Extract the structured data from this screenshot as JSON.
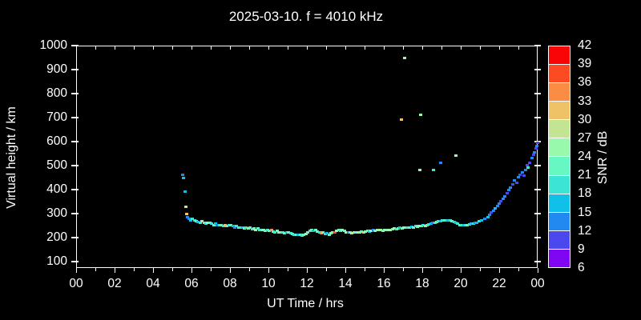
{
  "title": "2025-03-10. f = 4010 kHz",
  "axes": {
    "x": {
      "label": "UT Time / hrs",
      "range": [
        0,
        24
      ],
      "major_tick_hours": [
        0,
        2,
        4,
        6,
        8,
        10,
        12,
        14,
        16,
        18,
        20,
        22,
        24
      ],
      "tick_labels": [
        "00",
        "02",
        "04",
        "06",
        "08",
        "10",
        "12",
        "14",
        "16",
        "18",
        "20",
        "22",
        "00"
      ],
      "minor_tick_hours": [
        1,
        3,
        5,
        7,
        9,
        11,
        13,
        15,
        17,
        19,
        21,
        23
      ]
    },
    "y": {
      "label": "Virtual height / km",
      "range": [
        73,
        1000
      ],
      "tick_values": [
        100,
        200,
        300,
        400,
        500,
        600,
        700,
        800,
        900,
        1000
      ]
    }
  },
  "colorbar": {
    "label": "SNR / dB",
    "tick_values": [
      6,
      9,
      12,
      15,
      18,
      21,
      24,
      27,
      30,
      33,
      36,
      39,
      42
    ],
    "segment_colors_bottom_to_top": [
      "#7F05F3",
      "#4B48EE",
      "#2289F0",
      "#10C0E8",
      "#3BE4D4",
      "#66F7C2",
      "#98F8AB",
      "#C3E593",
      "#EFC268",
      "#FB8C44",
      "#FC4A22",
      "#FA0505"
    ],
    "background": "#000000",
    "foreground": "#ffffff"
  },
  "chart_data": {
    "type": "scatter",
    "title": "2025-03-10. f = 4010 kHz",
    "xlabel": "UT Time / hrs",
    "ylabel": "Virtual height / km",
    "zlabel": "SNR / dB",
    "xlim": [
      0,
      24
    ],
    "ylim": [
      73,
      1000
    ],
    "zlim": [
      6,
      42
    ],
    "grid": false,
    "point_format": "[time_hours, virtual_height_km, snr_db]",
    "points": [
      [
        5.55,
        460,
        13
      ],
      [
        5.6,
        447,
        16
      ],
      [
        5.67,
        390,
        16
      ],
      [
        5.72,
        327,
        28
      ],
      [
        5.76,
        298,
        31
      ],
      [
        5.8,
        285,
        13
      ],
      [
        5.87,
        278,
        13
      ],
      [
        5.95,
        270,
        16
      ],
      [
        6.05,
        277,
        19
      ],
      [
        6.15,
        272,
        19
      ],
      [
        6.25,
        268,
        22
      ],
      [
        6.35,
        265,
        16
      ],
      [
        6.45,
        263,
        19
      ],
      [
        6.55,
        268,
        28
      ],
      [
        6.65,
        262,
        22
      ],
      [
        6.75,
        258,
        19
      ],
      [
        6.85,
        262,
        25
      ],
      [
        6.95,
        260,
        22
      ],
      [
        7.05,
        257,
        19
      ],
      [
        7.15,
        253,
        22
      ],
      [
        7.25,
        257,
        16
      ],
      [
        7.35,
        252,
        13
      ],
      [
        7.45,
        250,
        19
      ],
      [
        7.55,
        253,
        22
      ],
      [
        7.65,
        248,
        19
      ],
      [
        7.75,
        250,
        31
      ],
      [
        7.85,
        247,
        22
      ],
      [
        7.95,
        253,
        19
      ],
      [
        8.05,
        250,
        22
      ],
      [
        8.15,
        247,
        16
      ],
      [
        8.25,
        243,
        13
      ],
      [
        8.35,
        247,
        19
      ],
      [
        8.45,
        243,
        22
      ],
      [
        8.55,
        240,
        19
      ],
      [
        8.65,
        243,
        16
      ],
      [
        8.75,
        238,
        22
      ],
      [
        8.85,
        240,
        19
      ],
      [
        8.95,
        237,
        25
      ],
      [
        9.05,
        240,
        22
      ],
      [
        9.15,
        235,
        19
      ],
      [
        9.25,
        237,
        22
      ],
      [
        9.35,
        233,
        28
      ],
      [
        9.45,
        237,
        22
      ],
      [
        9.55,
        233,
        19
      ],
      [
        9.65,
        230,
        22
      ],
      [
        9.75,
        233,
        25
      ],
      [
        9.85,
        228,
        22
      ],
      [
        9.95,
        230,
        19
      ],
      [
        10.05,
        227,
        22
      ],
      [
        10.15,
        230,
        34
      ],
      [
        10.25,
        225,
        22
      ],
      [
        10.35,
        223,
        19
      ],
      [
        10.45,
        227,
        22
      ],
      [
        10.55,
        223,
        25
      ],
      [
        10.65,
        220,
        22
      ],
      [
        10.75,
        223,
        19
      ],
      [
        10.85,
        218,
        22
      ],
      [
        10.95,
        220,
        16
      ],
      [
        11.05,
        223,
        22
      ],
      [
        11.15,
        218,
        19
      ],
      [
        11.25,
        215,
        22
      ],
      [
        11.35,
        212,
        19
      ],
      [
        11.45,
        210,
        22
      ],
      [
        11.55,
        213,
        16
      ],
      [
        11.65,
        210,
        22
      ],
      [
        11.75,
        208,
        19
      ],
      [
        11.85,
        212,
        22
      ],
      [
        11.95,
        215,
        25
      ],
      [
        12.05,
        220,
        22
      ],
      [
        12.15,
        228,
        19
      ],
      [
        12.25,
        230,
        22
      ],
      [
        12.35,
        228,
        16
      ],
      [
        12.45,
        230,
        22
      ],
      [
        12.55,
        225,
        22
      ],
      [
        12.65,
        222,
        19
      ],
      [
        12.75,
        218,
        34
      ],
      [
        12.85,
        220,
        22
      ],
      [
        12.95,
        215,
        19
      ],
      [
        13.05,
        217,
        16
      ],
      [
        13.15,
        213,
        22
      ],
      [
        13.25,
        217,
        25
      ],
      [
        13.35,
        220,
        22
      ],
      [
        13.45,
        223,
        37
      ],
      [
        13.55,
        228,
        25
      ],
      [
        13.65,
        230,
        22
      ],
      [
        13.75,
        228,
        19
      ],
      [
        13.85,
        230,
        25
      ],
      [
        13.95,
        227,
        22
      ],
      [
        14.05,
        223,
        25
      ],
      [
        14.15,
        220,
        13
      ],
      [
        14.25,
        222,
        22
      ],
      [
        14.35,
        218,
        28
      ],
      [
        14.45,
        220,
        25
      ],
      [
        14.55,
        223,
        22
      ],
      [
        14.65,
        220,
        28
      ],
      [
        14.75,
        222,
        25
      ],
      [
        14.85,
        225,
        22
      ],
      [
        14.95,
        222,
        31
      ],
      [
        15.05,
        225,
        25
      ],
      [
        15.15,
        228,
        22
      ],
      [
        15.25,
        225,
        16
      ],
      [
        15.35,
        228,
        25
      ],
      [
        15.45,
        230,
        13
      ],
      [
        15.55,
        228,
        22
      ],
      [
        15.65,
        230,
        25
      ],
      [
        15.75,
        233,
        28
      ],
      [
        15.85,
        230,
        25
      ],
      [
        15.95,
        228,
        22
      ],
      [
        16.05,
        230,
        25
      ],
      [
        16.15,
        233,
        22
      ],
      [
        16.25,
        230,
        28
      ],
      [
        16.35,
        233,
        25
      ],
      [
        16.45,
        235,
        22
      ],
      [
        16.55,
        238,
        25
      ],
      [
        16.65,
        235,
        19
      ],
      [
        16.75,
        238,
        22
      ],
      [
        16.85,
        240,
        16
      ],
      [
        16.95,
        238,
        22
      ],
      [
        17.05,
        240,
        25
      ],
      [
        17.15,
        243,
        22
      ],
      [
        17.25,
        240,
        19
      ],
      [
        17.35,
        243,
        22
      ],
      [
        17.45,
        245,
        16
      ],
      [
        17.55,
        243,
        22
      ],
      [
        17.65,
        247,
        19
      ],
      [
        17.75,
        245,
        22
      ],
      [
        17.85,
        248,
        25
      ],
      [
        17.95,
        247,
        22
      ],
      [
        18.05,
        250,
        19
      ],
      [
        18.15,
        248,
        28
      ],
      [
        18.25,
        252,
        22
      ],
      [
        18.35,
        255,
        19
      ],
      [
        18.45,
        258,
        16
      ],
      [
        18.55,
        260,
        13
      ],
      [
        18.65,
        262,
        19
      ],
      [
        18.75,
        265,
        22
      ],
      [
        18.85,
        267,
        19
      ],
      [
        18.95,
        268,
        16
      ],
      [
        19.05,
        270,
        19
      ],
      [
        19.15,
        272,
        22
      ],
      [
        19.25,
        273,
        19
      ],
      [
        19.35,
        272,
        16
      ],
      [
        19.45,
        270,
        19
      ],
      [
        19.55,
        268,
        22
      ],
      [
        19.65,
        265,
        19
      ],
      [
        19.75,
        260,
        16
      ],
      [
        19.85,
        257,
        19
      ],
      [
        19.95,
        253,
        22
      ],
      [
        20.05,
        252,
        19
      ],
      [
        20.15,
        250,
        16
      ],
      [
        20.25,
        252,
        19
      ],
      [
        20.35,
        253,
        22
      ],
      [
        20.45,
        255,
        19
      ],
      [
        20.55,
        257,
        16
      ],
      [
        20.65,
        258,
        19
      ],
      [
        20.75,
        260,
        13
      ],
      [
        20.85,
        263,
        16
      ],
      [
        20.95,
        267,
        19
      ],
      [
        21.1,
        272,
        16
      ],
      [
        21.25,
        278,
        13
      ],
      [
        21.4,
        285,
        16
      ],
      [
        21.5,
        295,
        13
      ],
      [
        21.6,
        305,
        10
      ],
      [
        21.7,
        313,
        13
      ],
      [
        21.8,
        322,
        16
      ],
      [
        21.9,
        330,
        13
      ],
      [
        22.0,
        342,
        13
      ],
      [
        22.1,
        350,
        10
      ],
      [
        22.2,
        362,
        13
      ],
      [
        22.3,
        372,
        13
      ],
      [
        22.4,
        385,
        10
      ],
      [
        22.5,
        398,
        13
      ],
      [
        22.6,
        408,
        13
      ],
      [
        22.7,
        420,
        10
      ],
      [
        22.8,
        438,
        13
      ],
      [
        22.9,
        428,
        10
      ],
      [
        23.0,
        452,
        13
      ],
      [
        23.1,
        463,
        10
      ],
      [
        23.2,
        470,
        13
      ],
      [
        23.3,
        458,
        10
      ],
      [
        23.38,
        480,
        13
      ],
      [
        23.45,
        500,
        10
      ],
      [
        23.5,
        490,
        19
      ],
      [
        23.6,
        512,
        10
      ],
      [
        23.7,
        530,
        13
      ],
      [
        23.78,
        545,
        10
      ],
      [
        23.85,
        555,
        13
      ],
      [
        23.9,
        570,
        10
      ],
      [
        23.95,
        582,
        13
      ],
      [
        23.99,
        595,
        10
      ],
      [
        16.9,
        690,
        31
      ],
      [
        17.1,
        947,
        25
      ],
      [
        17.9,
        710,
        25
      ],
      [
        17.86,
        480,
        25
      ],
      [
        18.6,
        483,
        19
      ],
      [
        18.95,
        513,
        13
      ],
      [
        19.74,
        543,
        25
      ]
    ]
  }
}
